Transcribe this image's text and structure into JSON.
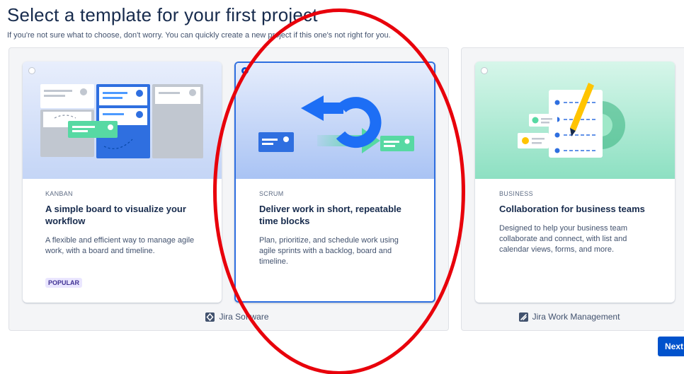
{
  "header": {
    "title": "Select a template for your first project",
    "subtitle": "If you're not sure what to choose, don't worry. You can quickly create a new project if this one's not right for you."
  },
  "groups": {
    "software": {
      "label": "Jira Software",
      "icon": "jira-software-icon"
    },
    "work_management": {
      "label": "Jira Work Management",
      "icon": "jira-work-management-icon"
    }
  },
  "cards": {
    "kanban": {
      "type": "KANBAN",
      "title": "A simple board to visualize your workflow",
      "description": "A flexible and efficient way to manage agile work, with a board and timeline.",
      "badge": "POPULAR",
      "selected": false
    },
    "scrum": {
      "type": "SCRUM",
      "title": "Deliver work in short, repeatable time blocks",
      "description": "Plan, prioritize, and schedule work using agile sprints with a backlog, board and timeline.",
      "selected": true
    },
    "business": {
      "type": "BUSINESS",
      "title": "Collaboration for business teams",
      "description": "Designed to help your business team collaborate and connect, with list and calendar views, forms, and more.",
      "selected": false
    }
  },
  "actions": {
    "next_label": "Next"
  },
  "colors": {
    "primary": "#0052cc",
    "selected_border": "#2f6fe0",
    "annotation": "#e8000b",
    "lozenge_bg": "#eae6ff",
    "lozenge_text": "#403294"
  }
}
